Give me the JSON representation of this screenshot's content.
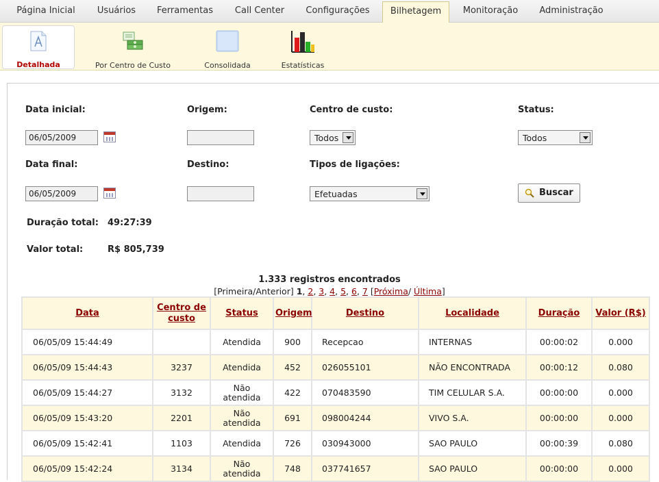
{
  "topnav": {
    "tabs": [
      {
        "label": "Página Inicial"
      },
      {
        "label": "Usuários"
      },
      {
        "label": "Ferramentas"
      },
      {
        "label": "Call Center"
      },
      {
        "label": "Configurações"
      },
      {
        "label": "Bilhetagem"
      },
      {
        "label": "Monitoração"
      },
      {
        "label": "Administração"
      }
    ],
    "active": "Bilhetagem"
  },
  "subnav": {
    "items": [
      {
        "label": "Detalhada",
        "icon": "document-icon"
      },
      {
        "label": "Por Centro de Custo",
        "icon": "money-stack-icon"
      },
      {
        "label": "Consolidada",
        "icon": "blank-sheet-icon"
      },
      {
        "label": "Estatísticas",
        "icon": "bar-chart-icon"
      }
    ],
    "active": "Detalhada"
  },
  "form": {
    "data_inicial_label": "Data inicial:",
    "data_inicial_value": "06/05/2009",
    "origem_label": "Origem:",
    "origem_value": "",
    "centro_custo_label": "Centro de custo:",
    "centro_custo_value": "Todos",
    "status_label": "Status:",
    "status_value": "Todos",
    "data_final_label": "Data final:",
    "data_final_value": "06/05/2009",
    "destino_label": "Destino:",
    "destino_value": "",
    "tipos_label": "Tipos de ligações:",
    "tipos_value": "Efetuadas",
    "buscar_label": "Buscar"
  },
  "summary": {
    "duracao_label": "Duração total:",
    "duracao_value": "49:27:39",
    "valor_label": "Valor total:",
    "valor_value": "R$ 805,739"
  },
  "results": {
    "count_text": "1.333 registros encontrados",
    "pager": {
      "first_prev": "[Primeira/Anterior]",
      "current": "1",
      "pages": [
        "2",
        "3",
        "4",
        "5",
        "6",
        "7"
      ],
      "next": "Próxima",
      "last": "Última"
    }
  },
  "table": {
    "headers": {
      "data": "Data",
      "centro": "Centro de custo",
      "status": "Status",
      "origem": "Origem",
      "destino": "Destino",
      "localidade": "Localidade",
      "duracao": "Duração",
      "valor": "Valor (R$)"
    },
    "rows": [
      {
        "data": "06/05/09 15:44:49",
        "centro": "",
        "status": "Atendida",
        "origem": "900",
        "destino": "Recepcao",
        "localidade": "INTERNAS",
        "duracao": "00:00:02",
        "valor": "0.000"
      },
      {
        "data": "06/05/09 15:44:43",
        "centro": "3237",
        "status": "Atendida",
        "origem": "452",
        "destino": "026055101",
        "localidade": "NÃO ENCONTRADA",
        "duracao": "00:00:12",
        "valor": "0.080"
      },
      {
        "data": "06/05/09 15:44:27",
        "centro": "3132",
        "status": "Não atendida",
        "origem": "422",
        "destino": "070483590",
        "localidade": "TIM CELULAR S.A.",
        "duracao": "00:00:00",
        "valor": "0.000"
      },
      {
        "data": "06/05/09 15:43:20",
        "centro": "2201",
        "status": "Não atendida",
        "origem": "691",
        "destino": "098004244",
        "localidade": "VIVO S.A.",
        "duracao": "00:00:00",
        "valor": "0.000"
      },
      {
        "data": "06/05/09 15:42:41",
        "centro": "1103",
        "status": "Atendida",
        "origem": "726",
        "destino": "030943000",
        "localidade": "SAO PAULO",
        "duracao": "00:00:39",
        "valor": "0.080"
      },
      {
        "data": "06/05/09 15:42:24",
        "centro": "3134",
        "status": "Não atendida",
        "origem": "748",
        "destino": "037741657",
        "localidade": "SAO PAULO",
        "duracao": "00:00:00",
        "valor": "0.000"
      }
    ]
  },
  "colors": {
    "accent": "#8b0000",
    "toolbar_bg": "#fdf8de",
    "row_alt_bg": "#fdf8de"
  }
}
